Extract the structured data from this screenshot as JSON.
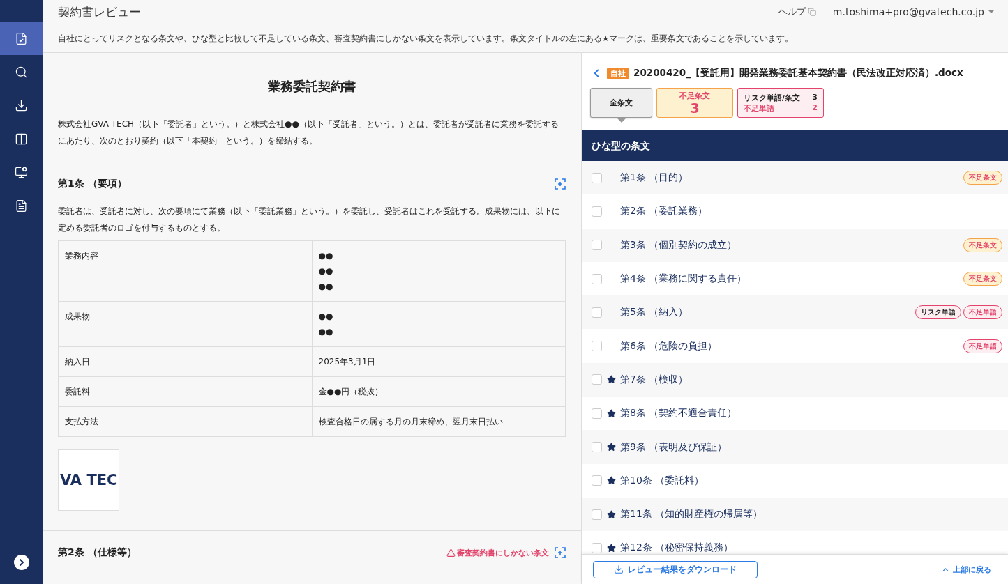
{
  "header": {
    "title": "契約書レビュー",
    "help": "ヘルプ",
    "user": "m.toshima+pro@gvatech.co.jp"
  },
  "sidebar": {
    "items": [
      {
        "kind": "review",
        "selected": true
      },
      {
        "kind": "search",
        "selected": false
      },
      {
        "kind": "download",
        "selected": false
      },
      {
        "kind": "compare",
        "selected": false
      },
      {
        "kind": "settings",
        "selected": false
      },
      {
        "kind": "document",
        "selected": false
      }
    ]
  },
  "notice": "自社にとってリスクとなる条文や、ひな型と比較して不足している条文、審査契約書にしかない条文を表示しています。条文タイトルの左にある★マークは、重要条文であることを示しています。",
  "document": {
    "title": "業務委託契約書",
    "preamble": "株式会社GVA TECH（以下「委託者」という。）と株式会社●●（以下「受託者」という。）とは、委託者が受託者に業務を委託するにあたり、次のとおり契約（以下「本契約」という。）を締結する。",
    "sections": [
      {
        "heading": "第1条 （要項）",
        "body": "委託者は、受託者に対し、次の要項にて業務（以下「委託業務」という。）を委託し、受託者はこれを受託する。成果物には、以下に定める委託者のロゴを付与するものとする。",
        "table": [
          {
            "label": "業務内容",
            "values": [
              "●●",
              "●●",
              "●●"
            ]
          },
          {
            "label": "成果物",
            "values": [
              "●●",
              "●●"
            ]
          },
          {
            "label": "納入日",
            "values": [
              "2025年3月1日"
            ]
          },
          {
            "label": "委託料",
            "values": [
              "金●●円（税抜）"
            ]
          },
          {
            "label": "支払方法",
            "values": [
              "検査合格日の属する月の月末締め、翌月末日払い"
            ]
          }
        ],
        "logo_text": "VA TEC"
      },
      {
        "heading": "第2条 （仕様等）",
        "warning": "審査契約書にしかない条文"
      }
    ]
  },
  "panel": {
    "badge": "自社",
    "filename": "20200420_【受託用】開発業務委託基本契約書（民法改正対応済）.docx",
    "filters": [
      {
        "kind": "all",
        "label": "全条文",
        "selected": true
      },
      {
        "kind": "shortage",
        "label": "不足条文",
        "count": "3",
        "selected": false
      },
      {
        "kind": "words",
        "lines": [
          {
            "label": "リスク単語/条文",
            "count": "3"
          },
          {
            "label": "不足単語",
            "count": "2"
          }
        ],
        "selected": false
      }
    ],
    "list_title": "ひな型の条文",
    "clauses": [
      {
        "title": "第1条 （目的）",
        "important": false,
        "checked": false,
        "tags": [
          {
            "kind": "shortage",
            "label": "不足条文"
          }
        ]
      },
      {
        "title": "第2条 （委託業務）",
        "important": false,
        "checked": false
      },
      {
        "title": "第3条 （個別契約の成立）",
        "important": false,
        "checked": false,
        "tags": [
          {
            "kind": "shortage",
            "label": "不足条文"
          }
        ]
      },
      {
        "title": "第4条 （業務に関する責任）",
        "important": false,
        "checked": false,
        "tags": [
          {
            "kind": "shortage",
            "label": "不足条文"
          }
        ]
      },
      {
        "title": "第5条 （納入）",
        "important": false,
        "checked": false,
        "tags": [
          {
            "kind": "risk",
            "label": "リスク単語"
          },
          {
            "kind": "missing",
            "label": "不足単語"
          }
        ]
      },
      {
        "title": "第6条 （危険の負担）",
        "important": false,
        "checked": false,
        "tags": [
          {
            "kind": "missing",
            "label": "不足単語"
          }
        ]
      },
      {
        "title": "第7条 （検収）",
        "important": true,
        "checked": false
      },
      {
        "title": "第8条 （契約不適合責任）",
        "important": true,
        "checked": false
      },
      {
        "title": "第9条 （表明及び保証）",
        "important": true,
        "checked": false
      },
      {
        "title": "第10条 （委託料）",
        "important": true,
        "checked": false
      },
      {
        "title": "第11条 （知的財産権の帰属等）",
        "important": true,
        "checked": false
      },
      {
        "title": "第12条 （秘密保持義務）",
        "important": true,
        "checked": false
      }
    ],
    "download": "レビュー結果をダウンロード",
    "back_to_top": "上部に戻る"
  }
}
